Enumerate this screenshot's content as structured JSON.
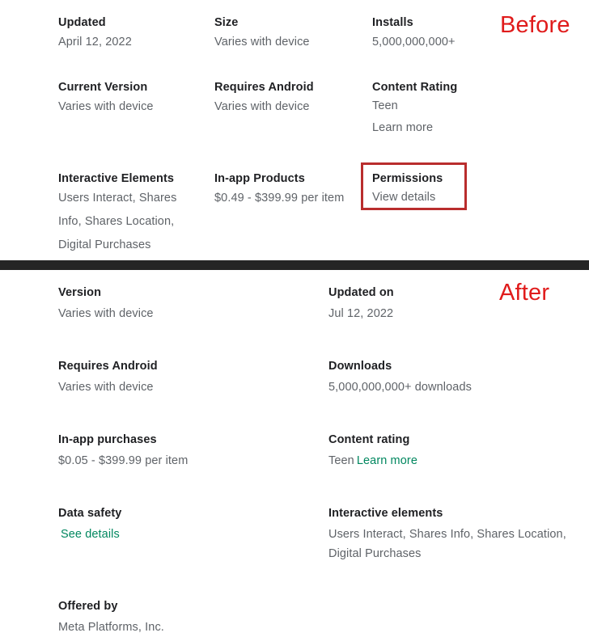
{
  "annotations": {
    "before_tag": "Before",
    "after_tag": "After",
    "accent_red": "#e01b1b",
    "highlight_border": "#b92d2d",
    "divider_color": "#252525",
    "link_green": "#01875f",
    "value_gray": "#5f6368",
    "label_black": "#202124"
  },
  "before": {
    "rows": [
      {
        "cells": [
          {
            "label": "Updated",
            "value": "April 12, 2022"
          },
          {
            "label": "Size",
            "value": "Varies with device"
          },
          {
            "label": "Installs",
            "value": "5,000,000,000+"
          }
        ]
      },
      {
        "cells": [
          {
            "label": "Current Version",
            "value": "Varies with device"
          },
          {
            "label": "Requires Android",
            "value": "Varies with device"
          },
          {
            "label": "Content Rating",
            "value": "Teen",
            "value2": "Learn more"
          }
        ]
      },
      {
        "cells": [
          {
            "label": "Interactive Elements",
            "value": "Users Interact, Shares Info, Shares Location, Digital Purchases"
          },
          {
            "label": "In-app Products",
            "value": "$0.49 - $399.99 per item"
          },
          {
            "label": "Permissions",
            "value": "View details"
          }
        ]
      }
    ]
  },
  "after": {
    "rows": [
      {
        "left": {
          "label": "Version",
          "value": "Varies with device"
        },
        "right": {
          "label": "Updated on",
          "value": "Jul 12, 2022"
        }
      },
      {
        "left": {
          "label": "Requires Android",
          "value": "Varies with device"
        },
        "right": {
          "label": "Downloads",
          "value": "5,000,000,000+ downloads"
        }
      },
      {
        "left": {
          "label": "In-app purchases",
          "value": "$0.05 - $399.99 per item"
        },
        "right": {
          "label": "Content rating",
          "value": "Teen",
          "link": "Learn more"
        }
      },
      {
        "left": {
          "label": "Data safety",
          "link": "See details"
        },
        "right": {
          "label": "Interactive elements",
          "value": "Users Interact, Shares Info, Shares Location, Digital Purchases"
        }
      },
      {
        "left": {
          "label": "Offered by",
          "value": "Meta Platforms, Inc."
        },
        "right": {
          "label": "",
          "value": ""
        }
      }
    ]
  }
}
